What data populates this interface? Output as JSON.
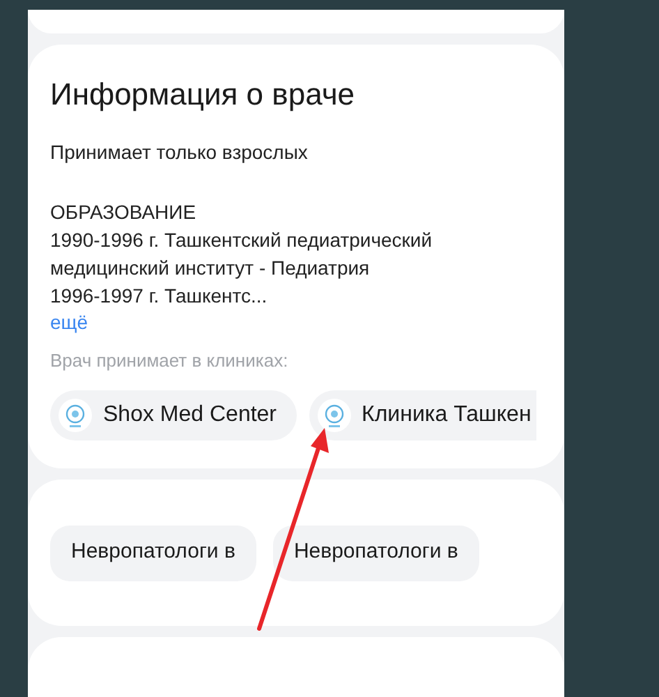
{
  "doctor_info": {
    "title": "Информация о враче",
    "note": "Принимает только взрослых",
    "education_heading": "ОБРАЗОВАНИЕ",
    "education_lines": [
      "1990-1996 г. Ташкентский педиатрический",
      "медицинский институт - Педиатрия",
      "1996-1997 г. Ташкентс..."
    ],
    "more_link": "ещё",
    "clinics_label": "Врач принимает в клиниках:",
    "clinics": [
      {
        "name": "Shox Med Center"
      },
      {
        "name": "Клиника Ташкен"
      }
    ]
  },
  "specialty_links": [
    "Невропатологи в",
    "Невропатологи в"
  ]
}
